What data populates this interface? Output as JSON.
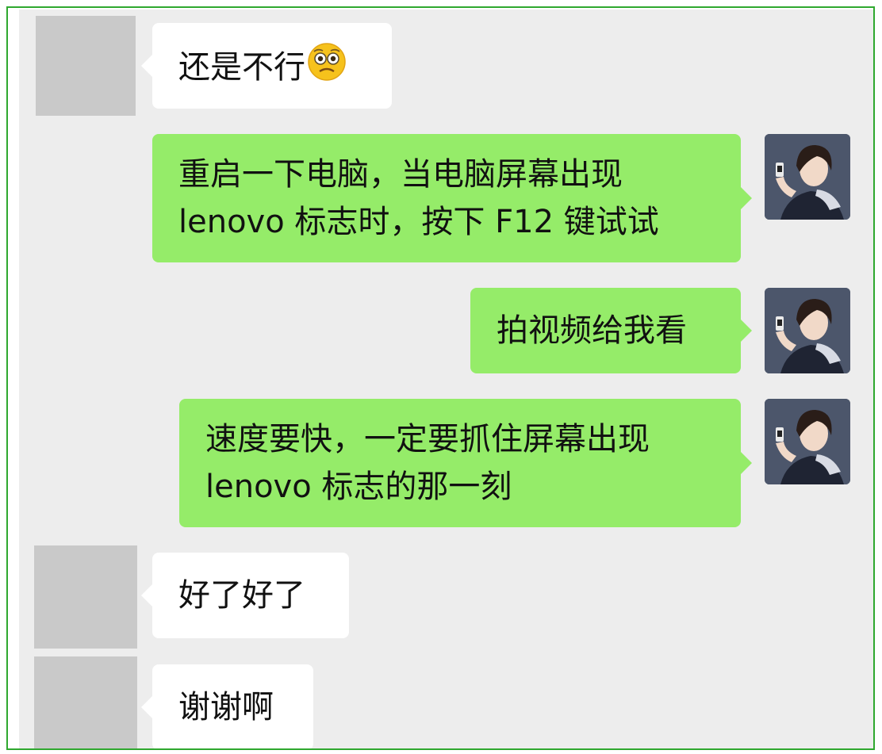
{
  "messages": [
    {
      "sender": "other",
      "text": "还是不行",
      "emoji": "woozy-face-emoji"
    },
    {
      "sender": "me",
      "lines": [
        "重启一下电脑，当电脑屏幕出现",
        "lenovo 标志时，按下 F12 键试试"
      ]
    },
    {
      "sender": "me",
      "text": "拍视频给我看"
    },
    {
      "sender": "me",
      "lines": [
        "速度要快，一定要抓住屏幕出现",
        "lenovo 标志的那一刻"
      ]
    },
    {
      "sender": "other",
      "text": "好了好了"
    },
    {
      "sender": "other",
      "text": "谢谢啊"
    }
  ],
  "colors": {
    "chat_background": "#ededed",
    "incoming_bubble": "#ffffff",
    "outgoing_bubble": "#95ec69",
    "blank_avatar": "#c9c9c9",
    "frame_border": "#2fa82f"
  }
}
